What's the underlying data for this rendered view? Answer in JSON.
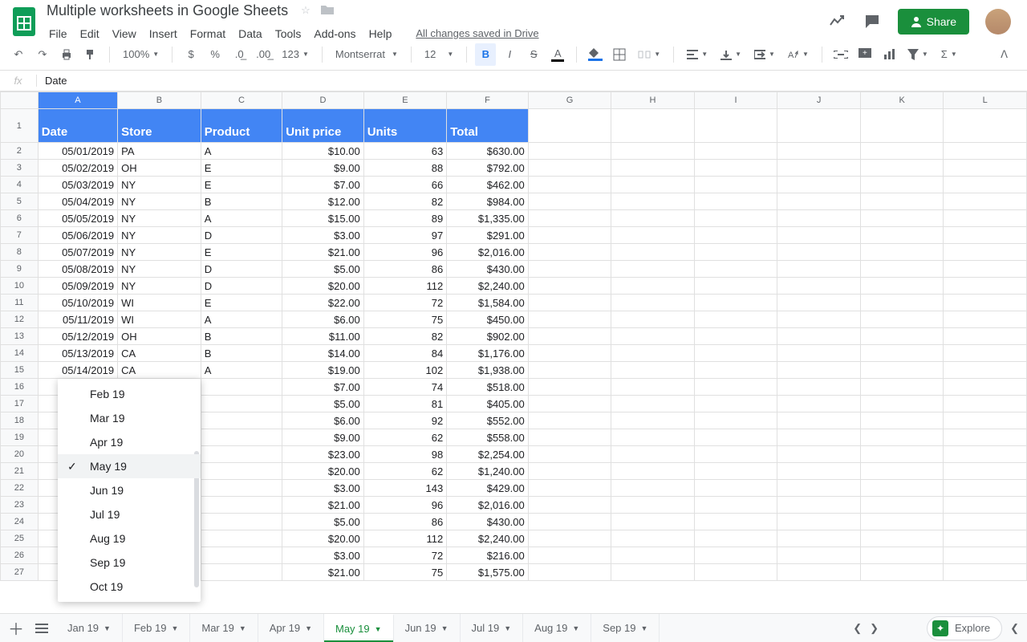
{
  "doc_title": "Multiple worksheets in Google Sheets",
  "menus": [
    "File",
    "Edit",
    "View",
    "Insert",
    "Format",
    "Data",
    "Tools",
    "Add-ons",
    "Help"
  ],
  "save_status": "All changes saved in Drive",
  "share_label": "Share",
  "toolbar": {
    "zoom": "100%",
    "num_fmt": "123",
    "font": "Montserrat",
    "font_size": "12"
  },
  "fx_value": "Date",
  "col_letters": [
    "A",
    "B",
    "C",
    "D",
    "E",
    "F",
    "G",
    "H",
    "I",
    "J",
    "K",
    "L"
  ],
  "headers": [
    "Date",
    "Store",
    "Product",
    "Unit price",
    "Units",
    "Total"
  ],
  "rows": [
    {
      "n": 2,
      "d": "05/01/2019",
      "s": "PA",
      "p": "A",
      "up": "$10.00",
      "u": "63",
      "t": "$630.00"
    },
    {
      "n": 3,
      "d": "05/02/2019",
      "s": "OH",
      "p": "E",
      "up": "$9.00",
      "u": "88",
      "t": "$792.00"
    },
    {
      "n": 4,
      "d": "05/03/2019",
      "s": "NY",
      "p": "E",
      "up": "$7.00",
      "u": "66",
      "t": "$462.00"
    },
    {
      "n": 5,
      "d": "05/04/2019",
      "s": "NY",
      "p": "B",
      "up": "$12.00",
      "u": "82",
      "t": "$984.00"
    },
    {
      "n": 6,
      "d": "05/05/2019",
      "s": "NY",
      "p": "A",
      "up": "$15.00",
      "u": "89",
      "t": "$1,335.00"
    },
    {
      "n": 7,
      "d": "05/06/2019",
      "s": "NY",
      "p": "D",
      "up": "$3.00",
      "u": "97",
      "t": "$291.00"
    },
    {
      "n": 8,
      "d": "05/07/2019",
      "s": "NY",
      "p": "E",
      "up": "$21.00",
      "u": "96",
      "t": "$2,016.00"
    },
    {
      "n": 9,
      "d": "05/08/2019",
      "s": "NY",
      "p": "D",
      "up": "$5.00",
      "u": "86",
      "t": "$430.00"
    },
    {
      "n": 10,
      "d": "05/09/2019",
      "s": "NY",
      "p": "D",
      "up": "$20.00",
      "u": "112",
      "t": "$2,240.00"
    },
    {
      "n": 11,
      "d": "05/10/2019",
      "s": "WI",
      "p": "E",
      "up": "$22.00",
      "u": "72",
      "t": "$1,584.00"
    },
    {
      "n": 12,
      "d": "05/11/2019",
      "s": "WI",
      "p": "A",
      "up": "$6.00",
      "u": "75",
      "t": "$450.00"
    },
    {
      "n": 13,
      "d": "05/12/2019",
      "s": "OH",
      "p": "B",
      "up": "$11.00",
      "u": "82",
      "t": "$902.00"
    },
    {
      "n": 14,
      "d": "05/13/2019",
      "s": "CA",
      "p": "B",
      "up": "$14.00",
      "u": "84",
      "t": "$1,176.00"
    },
    {
      "n": 15,
      "d": "05/14/2019",
      "s": "CA",
      "p": "A",
      "up": "$19.00",
      "u": "102",
      "t": "$1,938.00"
    },
    {
      "n": 16,
      "d": "",
      "s": "",
      "p": "",
      "up": "$7.00",
      "u": "74",
      "t": "$518.00"
    },
    {
      "n": 17,
      "d": "",
      "s": "",
      "p": "",
      "up": "$5.00",
      "u": "81",
      "t": "$405.00"
    },
    {
      "n": 18,
      "d": "",
      "s": "",
      "p": "",
      "up": "$6.00",
      "u": "92",
      "t": "$552.00"
    },
    {
      "n": 19,
      "d": "",
      "s": "",
      "p": "",
      "up": "$9.00",
      "u": "62",
      "t": "$558.00"
    },
    {
      "n": 20,
      "d": "",
      "s": "",
      "p": "",
      "up": "$23.00",
      "u": "98",
      "t": "$2,254.00"
    },
    {
      "n": 21,
      "d": "",
      "s": "",
      "p": "",
      "up": "$20.00",
      "u": "62",
      "t": "$1,240.00"
    },
    {
      "n": 22,
      "d": "",
      "s": "",
      "p": "",
      "up": "$3.00",
      "u": "143",
      "t": "$429.00"
    },
    {
      "n": 23,
      "d": "",
      "s": "",
      "p": "",
      "up": "$21.00",
      "u": "96",
      "t": "$2,016.00"
    },
    {
      "n": 24,
      "d": "",
      "s": "",
      "p": "",
      "up": "$5.00",
      "u": "86",
      "t": "$430.00"
    },
    {
      "n": 25,
      "d": "",
      "s": "",
      "p": "",
      "up": "$20.00",
      "u": "112",
      "t": "$2,240.00"
    },
    {
      "n": 26,
      "d": "",
      "s": "",
      "p": "",
      "up": "$3.00",
      "u": "72",
      "t": "$216.00"
    },
    {
      "n": 27,
      "d": "",
      "s": "",
      "p": "",
      "up": "$21.00",
      "u": "75",
      "t": "$1,575.00"
    }
  ],
  "popup_items": [
    "Feb 19",
    "Mar 19",
    "Apr 19",
    "May 19",
    "Jun 19",
    "Jul 19",
    "Aug 19",
    "Sep 19",
    "Oct 19"
  ],
  "popup_selected": "May 19",
  "tabs": [
    "Jan 19",
    "Feb 19",
    "Mar 19",
    "Apr 19",
    "May 19",
    "Jun 19",
    "Jul 19",
    "Aug 19",
    "Sep 19"
  ],
  "active_tab": "May 19",
  "explore_label": "Explore"
}
